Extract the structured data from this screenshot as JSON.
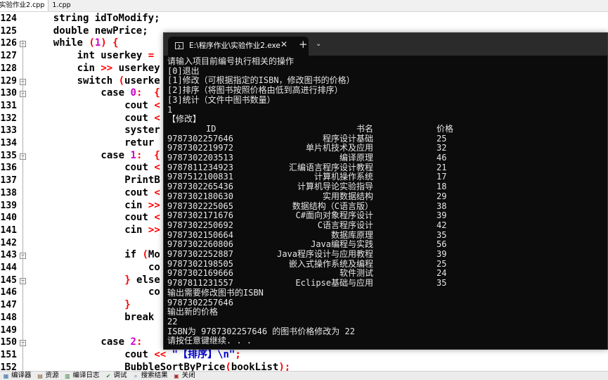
{
  "editor": {
    "tabs": [
      {
        "label": "实验作业2.cpp",
        "active": true
      },
      {
        "label": "1.cpp",
        "active": false
      }
    ],
    "lines": [
      {
        "num": "124",
        "fold": "",
        "indent": 2,
        "segments": [
          {
            "t": "string idToModify;",
            "c": "kw"
          }
        ]
      },
      {
        "num": "125",
        "fold": "",
        "indent": 2,
        "segments": [
          {
            "t": "double newPrice;",
            "c": "kw"
          }
        ]
      },
      {
        "num": "126",
        "fold": "−",
        "indent": 2,
        "segments": [
          {
            "t": "while ",
            "c": "kw"
          },
          {
            "t": "(",
            "c": "op"
          },
          {
            "t": "1",
            "c": "num"
          },
          {
            "t": ") {",
            "c": "op"
          }
        ]
      },
      {
        "num": "127",
        "fold": "",
        "indent": 4,
        "segments": [
          {
            "t": "int userkey ",
            "c": "kw"
          },
          {
            "t": "=",
            "c": "op"
          }
        ]
      },
      {
        "num": "128",
        "fold": "",
        "indent": 4,
        "segments": [
          {
            "t": "cin ",
            "c": "kw"
          },
          {
            "t": ">>",
            "c": "op"
          },
          {
            "t": " userkey",
            "c": "kw"
          }
        ]
      },
      {
        "num": "129",
        "fold": "−",
        "indent": 4,
        "segments": [
          {
            "t": "switch ",
            "c": "kw"
          },
          {
            "t": "(",
            "c": "op"
          },
          {
            "t": "userke",
            "c": "kw"
          }
        ]
      },
      {
        "num": "130",
        "fold": "−",
        "indent": 6,
        "segments": [
          {
            "t": "case ",
            "c": "kw"
          },
          {
            "t": "0",
            "c": "num"
          },
          {
            "t": ":",
            "c": "op"
          },
          {
            "t": "  ",
            "c": "kw"
          },
          {
            "t": "{",
            "c": "op"
          }
        ]
      },
      {
        "num": "131",
        "fold": "",
        "indent": 8,
        "segments": [
          {
            "t": "cout ",
            "c": "kw"
          },
          {
            "t": "<",
            "c": "op"
          }
        ]
      },
      {
        "num": "132",
        "fold": "",
        "indent": 8,
        "segments": [
          {
            "t": "cout ",
            "c": "kw"
          },
          {
            "t": "<",
            "c": "op"
          }
        ]
      },
      {
        "num": "133",
        "fold": "",
        "indent": 8,
        "segments": [
          {
            "t": "syster",
            "c": "kw"
          }
        ]
      },
      {
        "num": "134",
        "fold": "",
        "indent": 8,
        "segments": [
          {
            "t": "retur",
            "c": "kw"
          }
        ]
      },
      {
        "num": "135",
        "fold": "−",
        "indent": 6,
        "segments": [
          {
            "t": "case ",
            "c": "kw"
          },
          {
            "t": "1",
            "c": "num"
          },
          {
            "t": ":",
            "c": "op"
          },
          {
            "t": "  ",
            "c": "kw"
          },
          {
            "t": "{",
            "c": "op"
          }
        ]
      },
      {
        "num": "136",
        "fold": "",
        "indent": 8,
        "segments": [
          {
            "t": "cout ",
            "c": "kw"
          },
          {
            "t": "<",
            "c": "op"
          }
        ]
      },
      {
        "num": "137",
        "fold": "",
        "indent": 8,
        "segments": [
          {
            "t": "PrintB",
            "c": "kw"
          }
        ]
      },
      {
        "num": "138",
        "fold": "",
        "indent": 8,
        "segments": [
          {
            "t": "cout ",
            "c": "kw"
          },
          {
            "t": "<",
            "c": "op"
          }
        ]
      },
      {
        "num": "139",
        "fold": "",
        "indent": 8,
        "segments": [
          {
            "t": "cin ",
            "c": "kw"
          },
          {
            "t": ">>",
            "c": "op"
          }
        ]
      },
      {
        "num": "140",
        "fold": "",
        "indent": 8,
        "segments": [
          {
            "t": "cout ",
            "c": "kw"
          },
          {
            "t": "<",
            "c": "op"
          }
        ]
      },
      {
        "num": "141",
        "fold": "",
        "indent": 8,
        "segments": [
          {
            "t": "cin ",
            "c": "kw"
          },
          {
            "t": ">>",
            "c": "op"
          }
        ]
      },
      {
        "num": "142",
        "fold": "",
        "indent": 0,
        "segments": []
      },
      {
        "num": "143",
        "fold": "−",
        "indent": 8,
        "segments": [
          {
            "t": "if ",
            "c": "kw"
          },
          {
            "t": "(",
            "c": "op"
          },
          {
            "t": "Mo",
            "c": "kw"
          }
        ]
      },
      {
        "num": "144",
        "fold": "",
        "indent": 10,
        "segments": [
          {
            "t": "co",
            "c": "kw"
          }
        ]
      },
      {
        "num": "145",
        "fold": "−",
        "indent": 8,
        "segments": [
          {
            "t": "} ",
            "c": "op"
          },
          {
            "t": "else",
            "c": "kw"
          }
        ]
      },
      {
        "num": "146",
        "fold": "",
        "indent": 10,
        "segments": [
          {
            "t": "co",
            "c": "kw"
          }
        ]
      },
      {
        "num": "147",
        "fold": "",
        "indent": 8,
        "segments": [
          {
            "t": "}",
            "c": "op"
          }
        ]
      },
      {
        "num": "148",
        "fold": "",
        "indent": 8,
        "segments": [
          {
            "t": "break",
            "c": "kw"
          }
        ]
      },
      {
        "num": "149",
        "fold": "",
        "indent": 0,
        "segments": []
      },
      {
        "num": "150",
        "fold": "−",
        "indent": 6,
        "segments": [
          {
            "t": "case ",
            "c": "kw"
          },
          {
            "t": "2",
            "c": "num"
          },
          {
            "t": ":",
            "c": "op"
          }
        ]
      },
      {
        "num": "151",
        "fold": "",
        "indent": 8,
        "segments": [
          {
            "t": "cout ",
            "c": "kw"
          },
          {
            "t": "<< ",
            "c": "op"
          },
          {
            "t": "\"【排序】\\n\"",
            "c": "str"
          },
          {
            "t": ";",
            "c": "op"
          }
        ]
      },
      {
        "num": "152",
        "fold": "",
        "indent": 8,
        "segments": [
          {
            "t": "BubbleSortByPrice",
            "c": "kw"
          },
          {
            "t": "(",
            "c": "op"
          },
          {
            "t": "bookList",
            "c": "kw"
          },
          {
            "t": ");",
            "c": "op"
          }
        ]
      }
    ]
  },
  "status_bar": {
    "items": [
      {
        "label": "编译器",
        "icon": "compiler-icon"
      },
      {
        "label": "资源",
        "icon": "resources-icon"
      },
      {
        "label": "编译日志",
        "icon": "compile-log-icon"
      },
      {
        "label": "调试",
        "icon": "debug-icon"
      },
      {
        "label": "搜索结果",
        "icon": "search-results-icon"
      },
      {
        "label": "关闭",
        "icon": "close-icon"
      }
    ]
  },
  "terminal": {
    "tab_title": "E:\\程序作业\\实验作业2.exe",
    "close_glyph": "✕",
    "new_tab_glyph": "+",
    "dropdown_glyph": "⌄",
    "menu_lines": [
      "请输入项目前编号执行相关的操作",
      "[0]退出",
      "[1]修改（可根据指定的ISBN，修改图书的价格）",
      "[2]排序（将图书按照价格由低到高进行排序）",
      "[3]统计（文件中图书数量）",
      "1",
      "【修改】"
    ],
    "table_header": {
      "id": "ID",
      "name": "书名",
      "price": "价格"
    },
    "books": [
      {
        "id": "9787302257646",
        "name": "程序设计基础",
        "price": "25"
      },
      {
        "id": "9787302219972",
        "name": "单片机技术及应用",
        "price": "32"
      },
      {
        "id": "9787302203513",
        "name": "编译原理",
        "price": "46"
      },
      {
        "id": "9787811234923",
        "name": "汇编语言程序设计教程",
        "price": "21"
      },
      {
        "id": "9787512100831",
        "name": "计算机操作系统",
        "price": "17"
      },
      {
        "id": "9787302265436",
        "name": "计算机导论实验指导",
        "price": "18"
      },
      {
        "id": "9787302180630",
        "name": "实用数据结构",
        "price": "29"
      },
      {
        "id": "9787302225065",
        "name": "数据结构（C语言版）",
        "price": "38"
      },
      {
        "id": "9787302171676",
        "name": "C#面向对象程序设计",
        "price": "39"
      },
      {
        "id": "9787302250692",
        "name": "C语言程序设计",
        "price": "42"
      },
      {
        "id": "9787302150664",
        "name": "数据库原理",
        "price": "35"
      },
      {
        "id": "9787302260806",
        "name": "Java编程与实践",
        "price": "56"
      },
      {
        "id": "9787302252887",
        "name": "Java程序设计与应用教程",
        "price": "39"
      },
      {
        "id": "9787302198505",
        "name": "嵌入式操作系统及编程",
        "price": "25"
      },
      {
        "id": "9787302169666",
        "name": "软件测试",
        "price": "24"
      },
      {
        "id": "9787811231557",
        "name": "Eclipse基础与应用",
        "price": "35"
      }
    ],
    "tail_lines": [
      "输出需要修改图书的ISBN",
      "9787302257646",
      "输出新的价格",
      "22",
      "ISBN为 9787302257646 的图书价格修改为 22",
      "请按任意键继续. . ."
    ]
  }
}
